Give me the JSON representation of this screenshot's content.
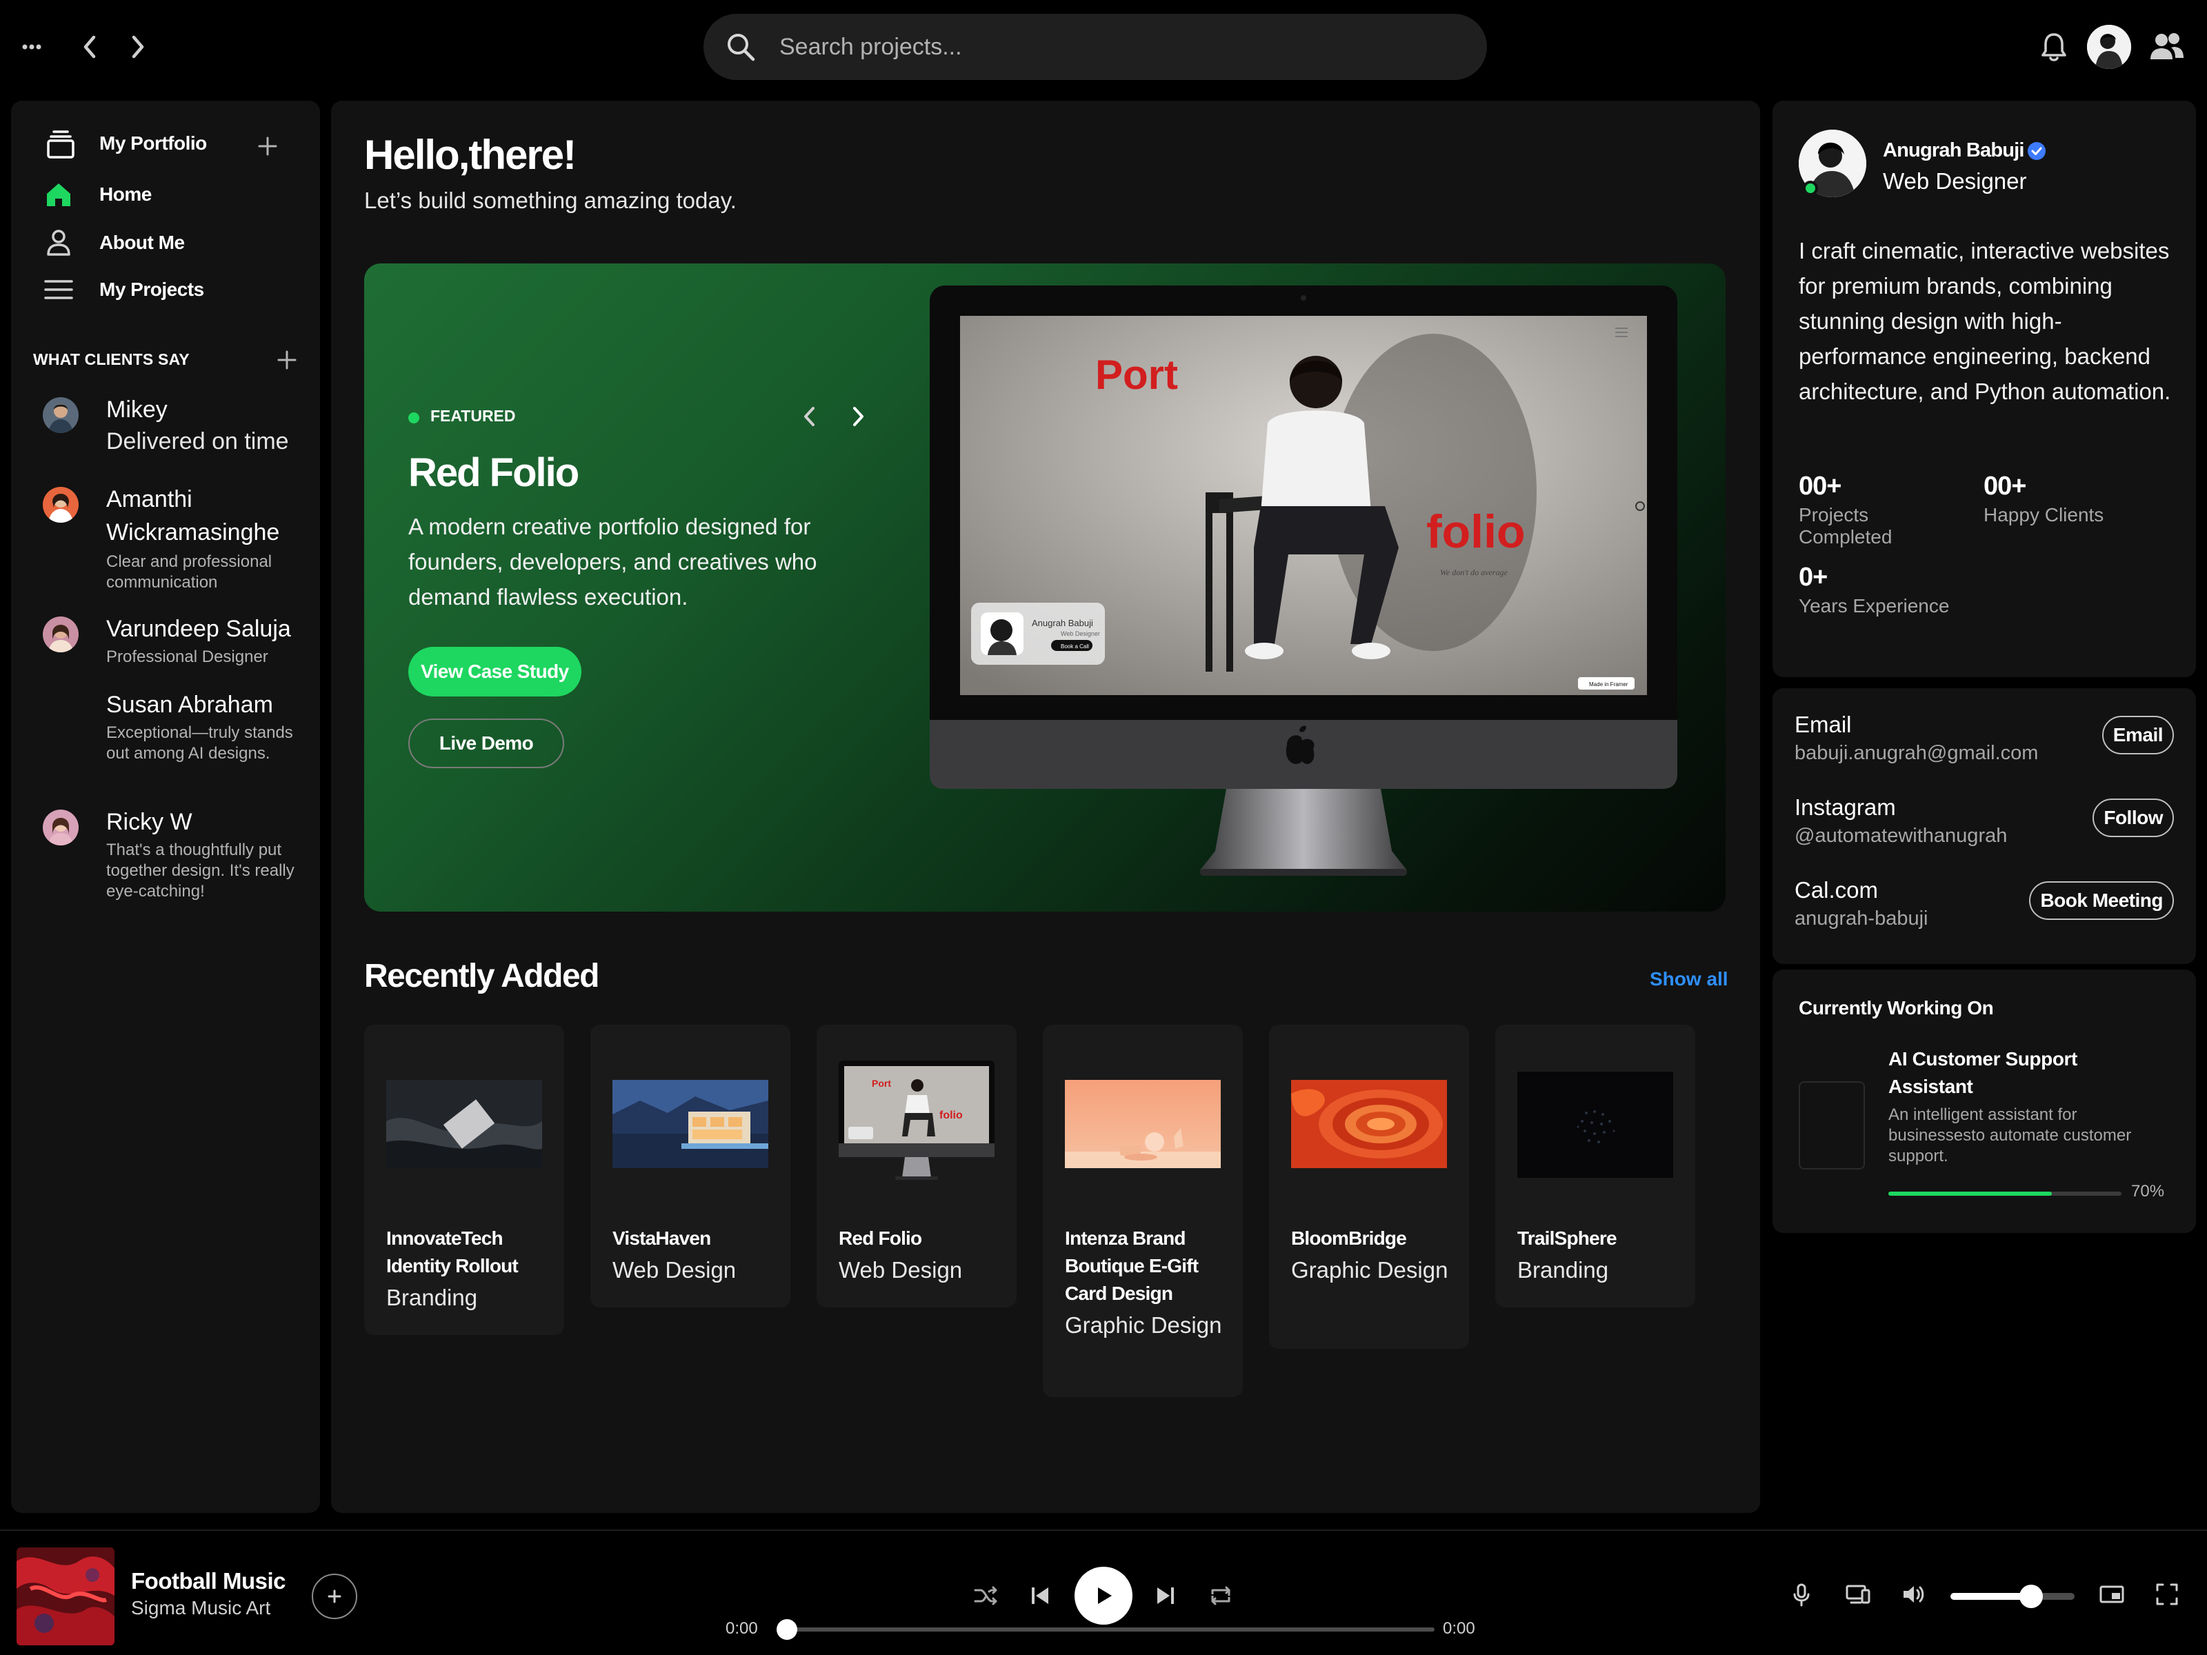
{
  "topbar": {
    "search_placeholder": "Search projects..."
  },
  "sidebar": {
    "library_title": "My Portfolio",
    "nav": [
      {
        "label": "Home"
      },
      {
        "label": "About Me"
      },
      {
        "label": "My Projects"
      }
    ],
    "section_title": "WHAT CLIENTS SAY",
    "testimonials": [
      {
        "name": "Mikey",
        "desc": "Delivered on time"
      },
      {
        "name": "Amanthi Wickramasinghe",
        "desc": "Clear and professional communication"
      },
      {
        "name": "Varundeep Saluja",
        "desc": "Professional Designer"
      },
      {
        "name": "Susan Abraham",
        "desc": "Exceptional—truly stands out among AI designs."
      },
      {
        "name": "Ricky W",
        "desc": "That's a thoughtfully put together design. It's really eye-catching!"
      }
    ]
  },
  "main": {
    "greeting": "Hello,there!",
    "subgreeting": "Let’s build something amazing today.",
    "featured": {
      "tag": "FEATURED",
      "title": "Red Folio",
      "description": "A modern creative portfolio designed for founders, developers, and creatives who demand flawless execution.",
      "primary_button": "View Case Study",
      "secondary_button": "Live Demo",
      "screen": {
        "word1": "Port",
        "word2": "folio",
        "tagline": "We don't do average",
        "card_name": "Anugrah Babuji",
        "card_role": "Web Designer",
        "card_button": "Book a Call",
        "badge": "Made in Framer"
      }
    },
    "recent_title": "Recently Added",
    "show_all": "Show all",
    "cards": [
      {
        "title": "InnovateTech Identity Rollout",
        "category": "Branding"
      },
      {
        "title": "VistaHaven",
        "category": "Web Design"
      },
      {
        "title": "Red Folio",
        "category": "Web Design"
      },
      {
        "title": "Intenza Brand Boutique E-Gift Card Design",
        "category": "Graphic Design"
      },
      {
        "title": "BloomBridge",
        "category": "Graphic Design"
      },
      {
        "title": "TrailSphere",
        "category": "Branding"
      }
    ]
  },
  "profile": {
    "name": "Anugrah Babuji",
    "role": "Web Designer",
    "bio": "I craft cinematic, interactive websites for premium brands, combining stunning design with high-performance engineering, backend architecture, and Python automation.",
    "stats": [
      {
        "value": "00+",
        "label": "Projects Completed"
      },
      {
        "value": "00+",
        "label": "Happy Clients"
      },
      {
        "value": "0+",
        "label": "Years Experience"
      }
    ]
  },
  "contacts": [
    {
      "label": "Email",
      "value": "babuji.anugrah@gmail.com",
      "button": "Email"
    },
    {
      "label": "Instagram",
      "value": "@automatewithanugrah",
      "button": "Follow"
    },
    {
      "label": "Cal.com",
      "value": "anugrah-babuji",
      "button": "Book Meeting"
    }
  ],
  "working_on": {
    "title": "Currently Working On",
    "project": "AI Customer Support Assistant",
    "description": "An intelligent assistant for businessesto automate customer support.",
    "progress": 0.7,
    "progress_label": "70%"
  },
  "player": {
    "track": "Football Music",
    "artist": "Sigma Music Art",
    "elapsed": "0:00",
    "duration": "0:00",
    "progress": 0.0,
    "volume": 0.65
  },
  "colors": {
    "accent": "#1ed760",
    "link": "#2e8fff",
    "panel": "#121212",
    "background": "#000000"
  }
}
